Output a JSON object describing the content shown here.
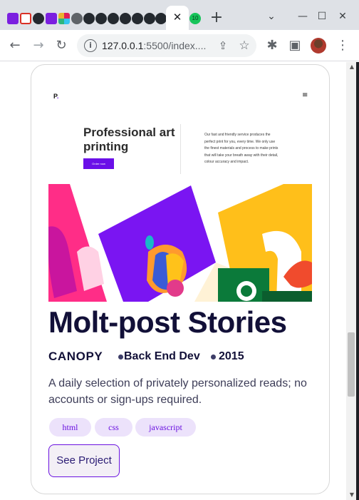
{
  "browser": {
    "active_tab_close": "✕",
    "new_tab": "+",
    "tab_dropdown": "⌄",
    "minimize": "—",
    "maximize": "☐",
    "close_window": "✕",
    "favicon_colors": [
      "#7b1fe0",
      "#d93025",
      "#24292f",
      "#7b1fe0",
      "#e8a33d",
      "#5f6368",
      "#24292f",
      "#24292f",
      "#24292f",
      "#24292f",
      "#24292f",
      "#24292f",
      "#24292f",
      "#16c45a"
    ],
    "tab_badge": "10",
    "url_host": "127.0.0.1",
    "url_rest": ":5500/index....",
    "nav_back": "←",
    "nav_forward": "→",
    "reload": "↻",
    "share_icon": "⇪",
    "star_icon": "☆",
    "extensions_icon": "✱",
    "sidebar_icon": "▣",
    "menu_icon": "⋮"
  },
  "mini_site": {
    "logo": "P",
    "logo_dot": ".",
    "menu_icon": "≡",
    "title": "Professional art printing",
    "button_label": "Order now",
    "description": "Our fast and friendly service produces the perfect print for you, every time. We only use the finest materials and process to make prints that will take your breath away with their detail, colour accuracy and impact.",
    "art_colors": [
      "#ff2d87",
      "#7a15f2",
      "#ffbf1a",
      "#0b7a3a",
      "#f04b2d"
    ]
  },
  "project": {
    "title": "Molt-post Stories",
    "client": "CANOPY",
    "role": "Back End Dev",
    "year": "2015",
    "description": "A daily selection of privately personalized reads; no accounts or sign-ups required.",
    "tags": [
      "html",
      "css",
      "javascript"
    ],
    "button": "See Project"
  },
  "accent": "#6a11e0"
}
